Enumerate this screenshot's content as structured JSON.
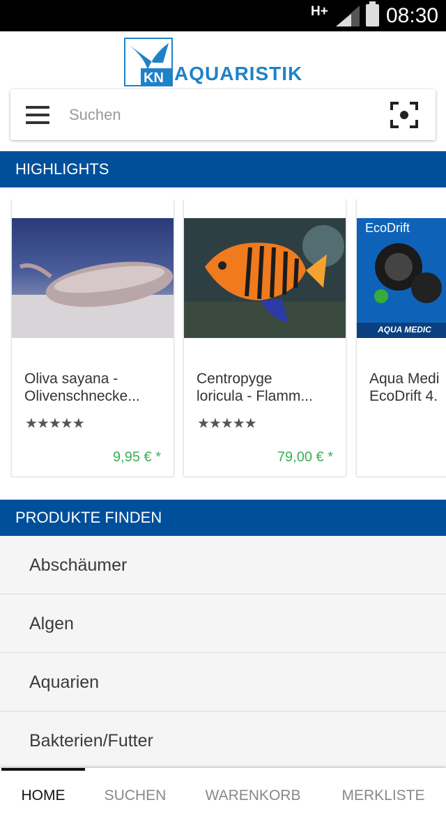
{
  "status_bar": {
    "network": "H+",
    "time": "08:30"
  },
  "brand": {
    "logo_text": "AQUARISTIK",
    "logo_mark_text": "KN",
    "primary_color": "#004f9a",
    "accent_color": "#1e82c8"
  },
  "search": {
    "placeholder": "Suchen",
    "value": ""
  },
  "highlights": {
    "title": "HIGHLIGHTS",
    "products": [
      {
        "name_line1": "Oliva sayana -",
        "name_line2": "Olivenschnecke...",
        "stars": "★★★★★",
        "price": "9,95 € *"
      },
      {
        "name_line1": "Centropyge",
        "name_line2": "loricula - Flamm...",
        "stars": "★★★★★",
        "price": "79,00 € *"
      },
      {
        "name_line1": "Aqua Medi",
        "name_line2": "EcoDrift 4.",
        "stars": "",
        "price": "",
        "image_label_top": "EcoDrift",
        "image_label_bottom": "AQUA MEDIC"
      }
    ]
  },
  "find_products": {
    "title": "PRODUKTE FINDEN",
    "categories": [
      "Abschäumer",
      "Algen",
      "Aquarien",
      "Bakterien/Futter"
    ]
  },
  "bottom_nav": {
    "tabs": [
      "HOME",
      "SUCHEN",
      "WARENKORB",
      "MERKLISTE"
    ],
    "active": "HOME"
  },
  "colors": {
    "price_green": "#3bae54",
    "header_blue": "#004f9a"
  }
}
